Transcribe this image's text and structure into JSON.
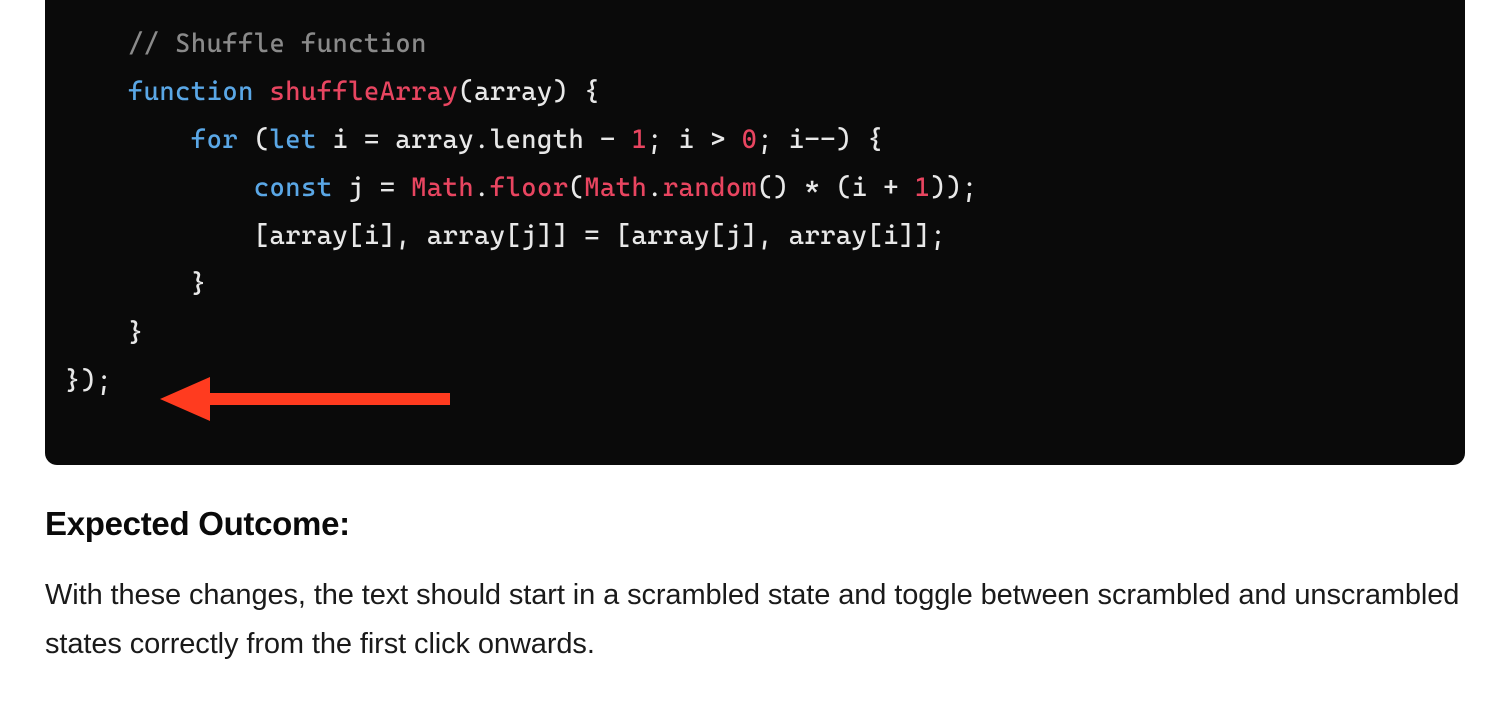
{
  "code": {
    "comment": "// Shuffle function",
    "line2_function": "function",
    "line2_name": "shuffleArray",
    "line2_rest": "(array) {",
    "line3_for": "for",
    "line3_open": " (",
    "line3_let": "let",
    "line3_mid1": " i = array.length - ",
    "line3_num1": "1",
    "line3_mid2": "; i > ",
    "line3_num0": "0",
    "line3_end": "; i--) {",
    "line4_const": "const",
    "line4_mid1": " j = ",
    "line4_math": "Math",
    "line4_dot1": ".",
    "line4_floor": "floor",
    "line4_open": "(",
    "line4_math2": "Math",
    "line4_dot2": ".",
    "line4_random": "random",
    "line4_mid2": "() * (i + ",
    "line4_num1": "1",
    "line4_end": "));",
    "line5": "[array[i], array[j]] = [array[j], array[i]];",
    "line6": "}",
    "line7": "}",
    "line8": "});"
  },
  "heading": "Expected Outcome:",
  "paragraph": "With these changes, the text should start in a scrambled state and toggle between scrambled and unscrambled states correctly from the first click onwards."
}
